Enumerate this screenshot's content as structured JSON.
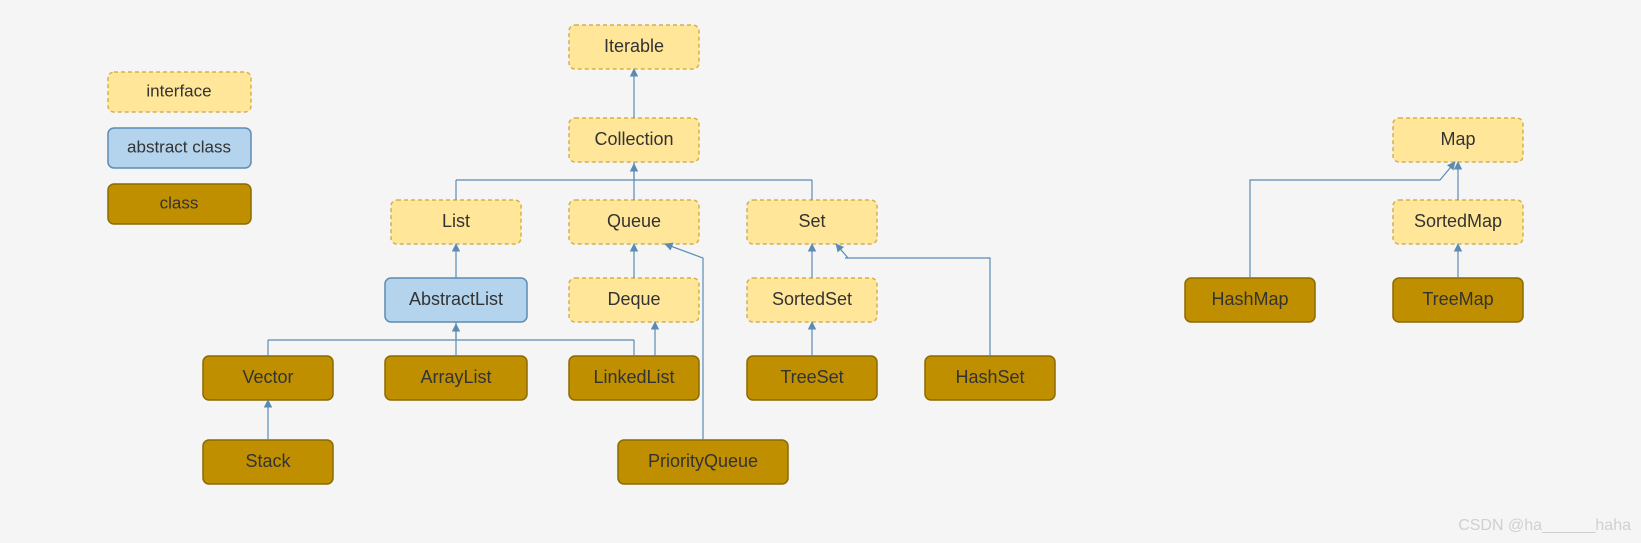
{
  "legend": {
    "interface": "interface",
    "abstract": "abstract class",
    "class": "class"
  },
  "nodes": {
    "iterable": "Iterable",
    "collection": "Collection",
    "list": "List",
    "queue": "Queue",
    "set": "Set",
    "abstractList": "AbstractList",
    "deque": "Deque",
    "sortedSet": "SortedSet",
    "vector": "Vector",
    "arrayList": "ArrayList",
    "linkedList": "LinkedList",
    "treeSet": "TreeSet",
    "hashSet": "HashSet",
    "stack": "Stack",
    "priorityQueue": "PriorityQueue",
    "map": "Map",
    "sortedMap": "SortedMap",
    "hashMap": "HashMap",
    "treeMap": "TreeMap"
  },
  "watermark": "CSDN @ha______haha",
  "colors": {
    "interface_fill": "#ffe699",
    "interface_stroke": "#d4b24c",
    "abstract_fill": "#b4d4ed",
    "abstract_stroke": "#5b8bb3",
    "class_fill": "#bf8f00",
    "class_stroke": "#8c6a00",
    "connector": "#5b8bb3"
  },
  "chart_data": {
    "type": "hierarchy",
    "legend": [
      "interface",
      "abstract class",
      "class"
    ],
    "edges": [
      [
        "Collection",
        "Iterable"
      ],
      [
        "List",
        "Collection"
      ],
      [
        "Queue",
        "Collection"
      ],
      [
        "Set",
        "Collection"
      ],
      [
        "AbstractList",
        "List"
      ],
      [
        "Deque",
        "Queue"
      ],
      [
        "SortedSet",
        "Set"
      ],
      [
        "Vector",
        "AbstractList"
      ],
      [
        "ArrayList",
        "AbstractList"
      ],
      [
        "LinkedList",
        "AbstractList"
      ],
      [
        "LinkedList",
        "Deque"
      ],
      [
        "TreeSet",
        "SortedSet"
      ],
      [
        "HashSet",
        "Set"
      ],
      [
        "Stack",
        "Vector"
      ],
      [
        "PriorityQueue",
        "Queue"
      ],
      [
        "SortedMap",
        "Map"
      ],
      [
        "HashMap",
        "Map"
      ],
      [
        "TreeMap",
        "SortedMap"
      ]
    ],
    "node_kinds": {
      "Iterable": "interface",
      "Collection": "interface",
      "List": "interface",
      "Queue": "interface",
      "Set": "interface",
      "Deque": "interface",
      "SortedSet": "interface",
      "Map": "interface",
      "SortedMap": "interface",
      "AbstractList": "abstract class",
      "Vector": "class",
      "ArrayList": "class",
      "LinkedList": "class",
      "TreeSet": "class",
      "HashSet": "class",
      "Stack": "class",
      "PriorityQueue": "class",
      "HashMap": "class",
      "TreeMap": "class"
    }
  }
}
